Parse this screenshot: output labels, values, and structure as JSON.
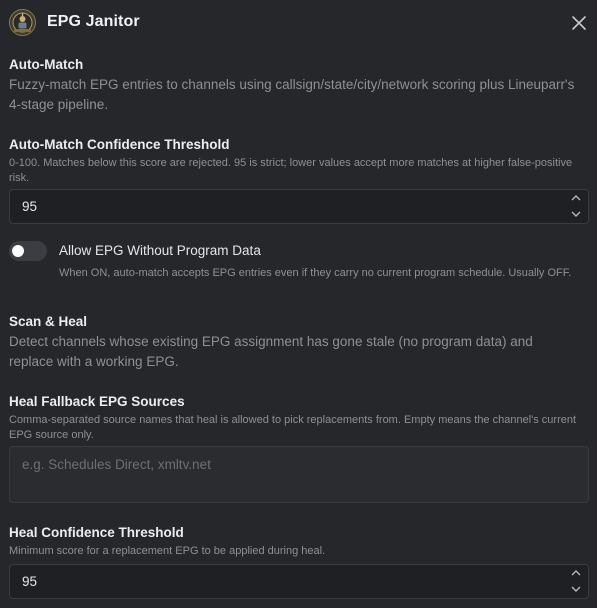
{
  "header": {
    "title": "EPG Janitor",
    "logo_icon": "janitor-badge-icon",
    "close_icon": "close-icon"
  },
  "auto_match": {
    "title": "Auto-Match",
    "description": "Fuzzy-match EPG entries to channels using callsign/state/city/network scoring plus Lineuparr's 4-stage pipeline."
  },
  "auto_match_threshold": {
    "label": "Auto-Match Confidence Threshold",
    "help": "0-100. Matches below this score are rejected. 95 is strict; lower values accept more matches at higher false-positive risk.",
    "value": "95"
  },
  "allow_no_program": {
    "label": "Allow EPG Without Program Data",
    "help": "When ON, auto-match accepts EPG entries even if they carry no current program schedule. Usually OFF.",
    "state": "off"
  },
  "scan_heal": {
    "title": "Scan & Heal",
    "description": "Detect channels whose existing EPG assignment has gone stale (no program data) and replace with a working EPG."
  },
  "heal_fallback": {
    "label": "Heal Fallback EPG Sources",
    "help": "Comma-separated source names that heal is allowed to pick replacements from. Empty means the channel's current EPG source only.",
    "placeholder": "e.g. Schedules Direct, xmltv.net",
    "value": ""
  },
  "heal_threshold": {
    "label": "Heal Confidence Threshold",
    "help": "Minimum score for a replacement EPG to be applied during heal.",
    "value": "95"
  },
  "colors": {
    "background": "#26272b",
    "input_background": "#1f2023",
    "muted_text": "#8f9096",
    "toggle_off": "#3c3d42"
  }
}
